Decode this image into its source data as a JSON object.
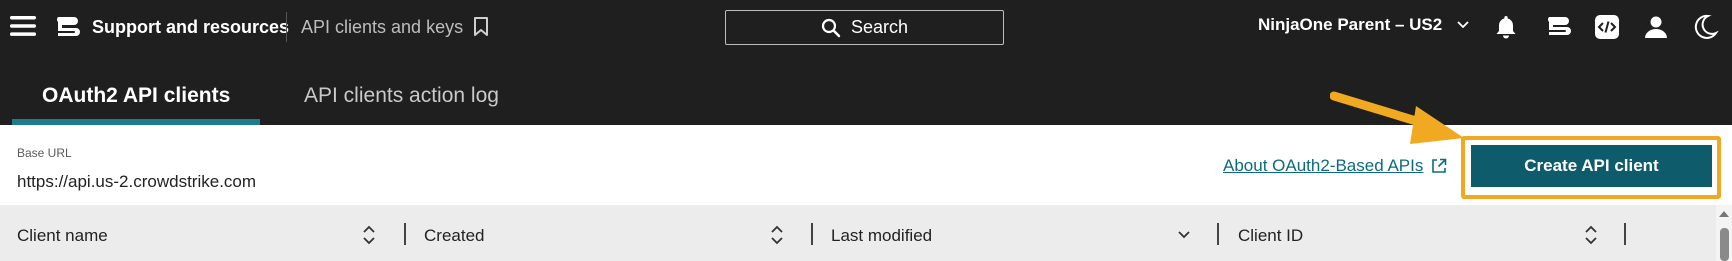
{
  "header": {
    "app_title": "Support and resources",
    "breadcrumb": "API clients and keys",
    "search_label": "Search",
    "tenant": "NinjaOne Parent – US2"
  },
  "tabs": [
    {
      "label": "OAuth2 API clients",
      "active": true
    },
    {
      "label": "API clients action log",
      "active": false
    }
  ],
  "panel": {
    "base_url_label": "Base URL",
    "base_url_value": "https://api.us-2.crowdstrike.com",
    "about_link": "About OAuth2-Based APIs",
    "create_button": "Create API client"
  },
  "table": {
    "columns": [
      "Client name",
      "Created",
      "Last modified",
      "Client ID"
    ]
  },
  "colors": {
    "topbar_bg": "#1f1f1f",
    "accent": "#0e5c6b",
    "link": "#0e6b7e",
    "highlight": "#f0a920"
  }
}
